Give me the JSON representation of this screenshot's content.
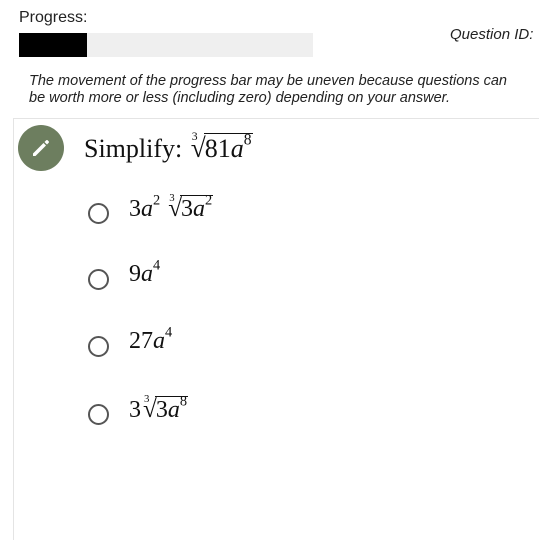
{
  "header": {
    "progress_label": "Progress:",
    "progress_fraction": 0.23,
    "question_id_label": "Question ID:"
  },
  "note": "The movement of the progress bar may be uneven because questions can\nbe worth more or less (including zero) depending on your answer.",
  "question": {
    "prompt": "Simplify:",
    "radical_index": "3",
    "radicand_coeff": "81",
    "radicand_var": "a",
    "radicand_exp": "8"
  },
  "options": [
    {
      "coeff": "3",
      "var": "a",
      "exp": "2",
      "radical_index": "3",
      "radicand_coeff": "3",
      "radicand_var": "a",
      "radicand_exp": "2"
    },
    {
      "coeff": "9",
      "var": "a",
      "exp": "4"
    },
    {
      "coeff": "27",
      "var": "a",
      "exp": "4"
    },
    {
      "coeff": "3",
      "radical_index": "3",
      "radicand_coeff": "3",
      "radicand_var": "a",
      "radicand_exp": "8"
    }
  ],
  "colors": {
    "progress_fill": "#000000",
    "progress_track": "#efefef",
    "edit_badge": "#6d7e5f"
  },
  "icons": {
    "edit": "pencil-icon",
    "option": "radio-circle"
  }
}
